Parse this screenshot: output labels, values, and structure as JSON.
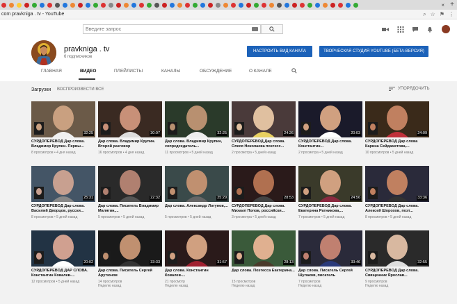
{
  "browser": {
    "tab_title": "pravknigа . tv - YouTube",
    "url": "com   pravkniga . tv - YouTube"
  },
  "masthead": {
    "search_placeholder": "Введите запрос",
    "icons": [
      "video-camera-icon",
      "apps-grid-icon",
      "messages-icon",
      "notifications-bell-icon",
      "account-avatar-icon"
    ]
  },
  "channel": {
    "name": "pravkniga . tv",
    "subscribers": "6 подписчиков",
    "customize_button": "НАСТРОИТЬ ВИД КАНАЛА",
    "studio_button": "ТВОРЧЕСКАЯ СТУДИЯ YOUTUBE (БЕТА-ВЕРСИЯ)"
  },
  "tabs": [
    "ГЛАВНАЯ",
    "ВИДЕО",
    "ПЛЕЙЛИСТЫ",
    "КАНАЛЫ",
    "ОБСУЖДЕНИЕ",
    "О КАНАЛЕ"
  ],
  "active_tab": "ВИДЕО",
  "uploads": {
    "title": "Загрузки",
    "play_all": "ВОСПРОИЗВЕСТИ ВСЕ",
    "sort": "УПОРЯДОЧИТЬ"
  },
  "videos": [
    {
      "title": "СУРДОПЕРЕВОД Дар слова. Владимир Крупин. Первы...",
      "views": "8 просмотров",
      "age": "4 дня назад",
      "duration": "32:25"
    },
    {
      "title": "Дар слова. Владимир Крупин. Второй разговор",
      "views": "16 просмотров",
      "age": "4 дня назад",
      "duration": "30:07"
    },
    {
      "title": "Дар слова. Владимир Крупин, сопредседатель...",
      "views": "11 просмотров",
      "age": "5 дней назад",
      "duration": "32:25"
    },
    {
      "title": "СУРДОПЕРЕВОД Дар слова. Олеся Николаева поэтесс...",
      "views": "2 просмотра",
      "age": "5 дней назад",
      "duration": "24:26"
    },
    {
      "title": "СУРДОПЕРЕВОД Дар слова. Константин...",
      "views": "2 просмотра",
      "age": "5 дней назад",
      "duration": "20:03"
    },
    {
      "title": "СУРДОПЕРЕВОД Дар слова Карина Сейдаметова,...",
      "views": "10 просмотров",
      "age": "5 дней назад",
      "duration": "24:09"
    },
    {
      "title": "СУРДОПЕРЕВОД Дар слова. Василий Дворцов, русски...",
      "views": "8 просмотров",
      "age": "5 дней назад",
      "duration": "25:31"
    },
    {
      "title": "Дар слова. Писатель Владимир Малягин,...",
      "views": "5 просмотров",
      "age": "5 дней назад",
      "duration": "22:32"
    },
    {
      "title": "Дар слова. Александр Логунов,...",
      "views": "5 просмотров",
      "age": "5 дней назад",
      "duration": "25:29"
    },
    {
      "title": "СУРДОПЕРЕВОД Дар слова. Михаил Попов, российски...",
      "views": "3 просмотра",
      "age": "5 дней назад",
      "duration": "28:53"
    },
    {
      "title": "СУРДОПЕРЕВОД Дар слова. Екатерина Ратникова,...",
      "views": "7 просмотров",
      "age": "5 дней назад",
      "duration": "24:56"
    },
    {
      "title": "СУРДОПЕРЕВОД Дар слова. Алексей Шорохов, поэт...",
      "views": "8 просмотров",
      "age": "5 дней назад",
      "duration": "33:36"
    },
    {
      "title": "СУРДОПЕРЕВОД ДАР СЛОВА. Константин Ковалев-...",
      "views": "12 просмотров",
      "age": "5 дней назад",
      "duration": "20:02"
    },
    {
      "title": "Дар слова. Писатель Сергей Арутюнов",
      "views": "14 просмотров",
      "age": "Неделю назад",
      "duration": "33:33"
    },
    {
      "title": "Дар слова. Константин Ковалев-...",
      "views": "21 просмотр",
      "age": "Неделю назад",
      "duration": "31:57"
    },
    {
      "title": "Дар слова. Поэтесса Екатерина...",
      "views": "15 просмотров",
      "age": "Неделю назад",
      "duration": "28:13"
    },
    {
      "title": "Дар слова. Писатель Сергей Шулаков, писатель",
      "views": "7 просмотров",
      "age": "Неделю назад",
      "duration": "33:46"
    },
    {
      "title": "СУРДОПЕРЕВОД Дар слова. Священник Ярослав...",
      "views": "9 просмотров",
      "age": "Неделю назад",
      "duration": "32:55"
    }
  ],
  "colors": {
    "accent_button": "#1c62b9",
    "content_bg": "#f2f2f2"
  }
}
